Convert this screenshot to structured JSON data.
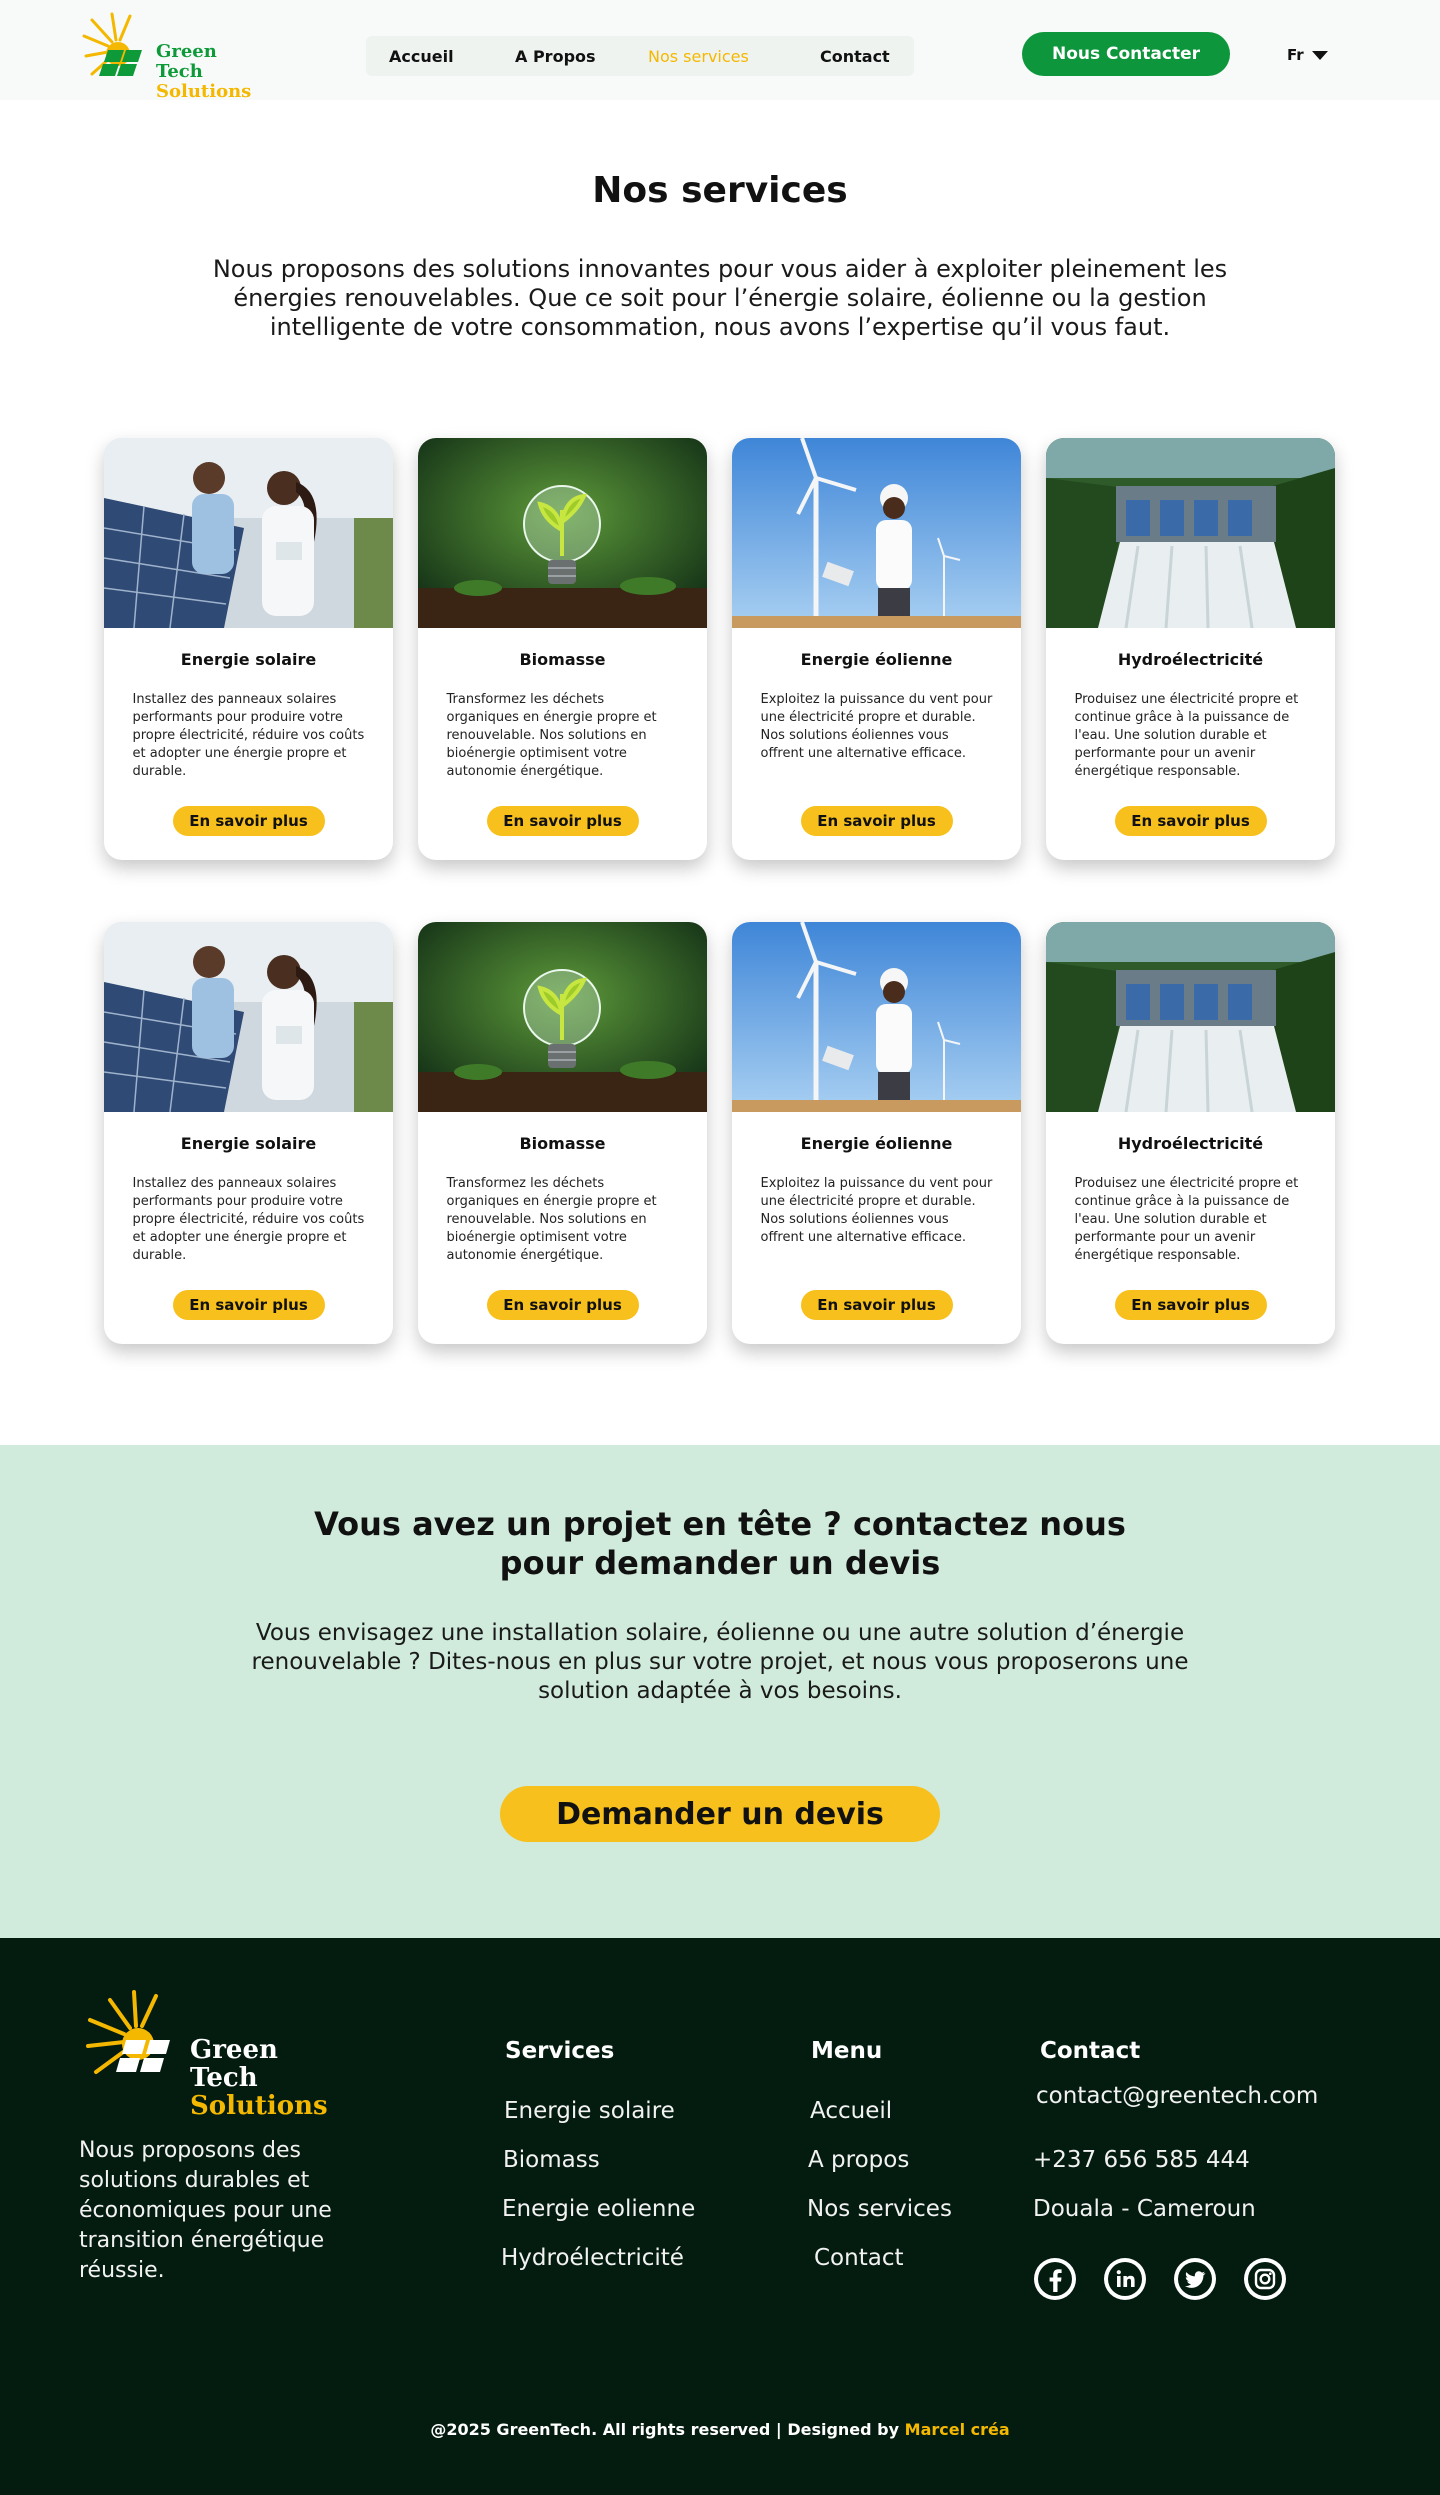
{
  "header": {
    "logo": {
      "line1": "Green Tech",
      "line2": "Solutions"
    },
    "nav": [
      {
        "label": "Accueil"
      },
      {
        "label": "A Propos"
      },
      {
        "label": "Nos services"
      },
      {
        "label": "Contact"
      }
    ],
    "cta_label": "Nous Contacter",
    "language": "Fr"
  },
  "intro": {
    "title": "Nos services",
    "text": "Nous proposons des solutions innovantes pour vous aider à exploiter pleinement les énergies renouvelables. Que ce soit pour l’énergie solaire, éolienne ou la gestion intelligente de votre consommation, nous avons l’expertise qu’il vous faut."
  },
  "cards_row1": [
    {
      "title": "Energie solaire",
      "text": "Installez des panneaux solaires performants pour produire votre propre électricité, réduire vos coûts et adopter une énergie propre et durable.",
      "button": "En savoir plus"
    },
    {
      "title": "Biomasse",
      "text": "Transformez les déchets organiques en énergie propre et renouvelable. Nos solutions en bioénergie optimisent votre autonomie énergétique.",
      "button": "En savoir plus"
    },
    {
      "title": "Energie éolienne",
      "text": "Exploitez la puissance du vent pour une électricité propre et durable. Nos solutions éoliennes vous offrent une alternative efficace.",
      "button": "En savoir plus"
    },
    {
      "title": "Hydroélectricité",
      "text": "Produisez une électricité propre et continue grâce à la puissance de l'eau. Une solution durable et performante pour un avenir énergétique responsable.",
      "button": "En savoir plus"
    }
  ],
  "cards_row2": [
    {
      "title": "Energie solaire",
      "text": "Installez des panneaux solaires performants pour produire votre propre électricité, réduire vos coûts et adopter une énergie propre et durable.",
      "button": "En savoir plus"
    },
    {
      "title": "Biomasse",
      "text": "Transformez les déchets organiques en énergie propre et renouvelable. Nos solutions en bioénergie optimisent votre autonomie énergétique.",
      "button": "En savoir plus"
    },
    {
      "title": "Energie éolienne",
      "text": "Exploitez la puissance du vent pour une électricité propre et durable. Nos solutions éoliennes vous offrent une alternative efficace.",
      "button": "En savoir plus"
    },
    {
      "title": "Hydroélectricité",
      "text": "Produisez une électricité propre et continue grâce à la puissance de l'eau. Une solution durable et performante pour un avenir énergétique responsable.",
      "button": "En savoir plus"
    }
  ],
  "band": {
    "title": "Vous avez un projet en tête ? contactez nous pour demander un devis",
    "text": "Vous envisagez une installation solaire, éolienne ou une autre solution d’énergie renouvelable ? Dites-nous en plus sur votre projet, et nous vous proposerons une solution adaptée à vos besoins.",
    "button": "Demander un devis"
  },
  "footer": {
    "logo": {
      "line1": "Green Tech",
      "line2": "Solutions"
    },
    "about": "Nous proposons des solutions durables et économiques pour une transition énergétique réussie.",
    "services_title": "Services",
    "services": [
      "Energie solaire",
      "Biomass",
      "Energie eolienne",
      "Hydroélectricité"
    ],
    "menu_title": "Menu",
    "menu": [
      "Accueil",
      "A propos",
      "Nos services",
      "Contact"
    ],
    "contact_title": "Contact",
    "email": "contact@greentech.com",
    "phone": "+237 656 585 444",
    "location": "Douala - Cameroun",
    "socials": [
      "facebook-icon",
      "linkedin-icon",
      "twitter-icon",
      "instagram-icon"
    ],
    "copyright": "@2025 GreenTech. All rights reserved | Designed by ",
    "designer": "Marcel créa"
  },
  "colors": {
    "brand_green": "#0d963c",
    "accent_yellow": "#f7c01c",
    "band_bg": "#d0ebdc",
    "footer_bg": "#041c10"
  }
}
